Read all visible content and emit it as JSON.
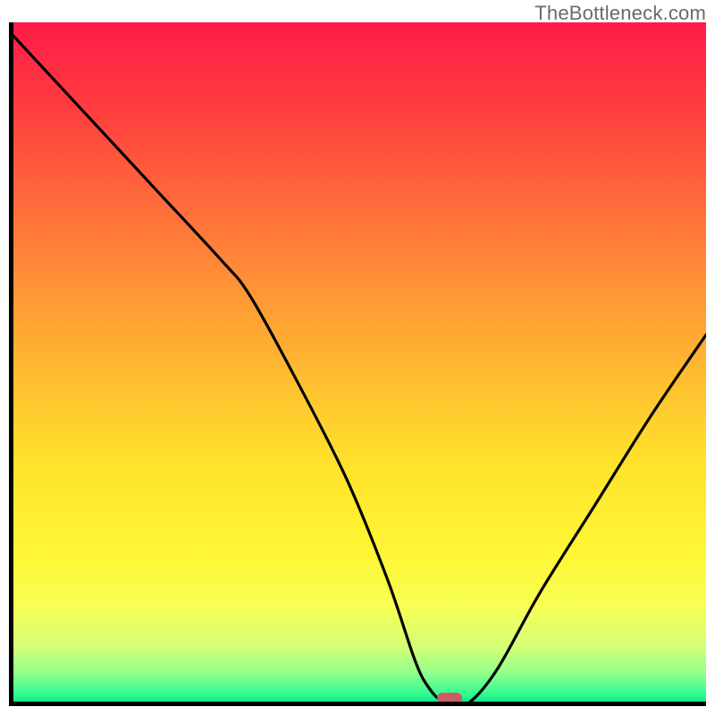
{
  "watermark": "TheBottleneck.com",
  "marker_color": "#ce5d61",
  "chart_data": {
    "type": "line",
    "title": "",
    "xlabel": "",
    "ylabel": "",
    "xlim": [
      0,
      100
    ],
    "ylim": [
      0,
      100
    ],
    "grid": false,
    "background": "gradient red-yellow-green (bottleneck %)",
    "series": [
      {
        "name": "bottleneck-curve",
        "x": [
          0,
          10,
          20,
          30,
          34,
          40,
          48,
          54,
          58,
          60,
          62,
          64,
          66,
          70,
          76,
          84,
          92,
          100
        ],
        "y": [
          98,
          87,
          76,
          65,
          60,
          49,
          33,
          18,
          6,
          2,
          0,
          0,
          0,
          5,
          16,
          29,
          42,
          54
        ]
      }
    ],
    "optimal_marker_x": 62.5,
    "gradient_stops": [
      {
        "pct": 0,
        "color": "#ff1c48"
      },
      {
        "pct": 12,
        "color": "#ff3b3f"
      },
      {
        "pct": 30,
        "color": "#ff763a"
      },
      {
        "pct": 50,
        "color": "#ffb631"
      },
      {
        "pct": 65,
        "color": "#ffe22c"
      },
      {
        "pct": 78,
        "color": "#fff634"
      },
      {
        "pct": 86,
        "color": "#f6ff55"
      },
      {
        "pct": 92,
        "color": "#d3ff77"
      },
      {
        "pct": 96,
        "color": "#8dff8b"
      },
      {
        "pct": 99,
        "color": "#2efb92"
      },
      {
        "pct": 100,
        "color": "#12e787"
      }
    ]
  }
}
